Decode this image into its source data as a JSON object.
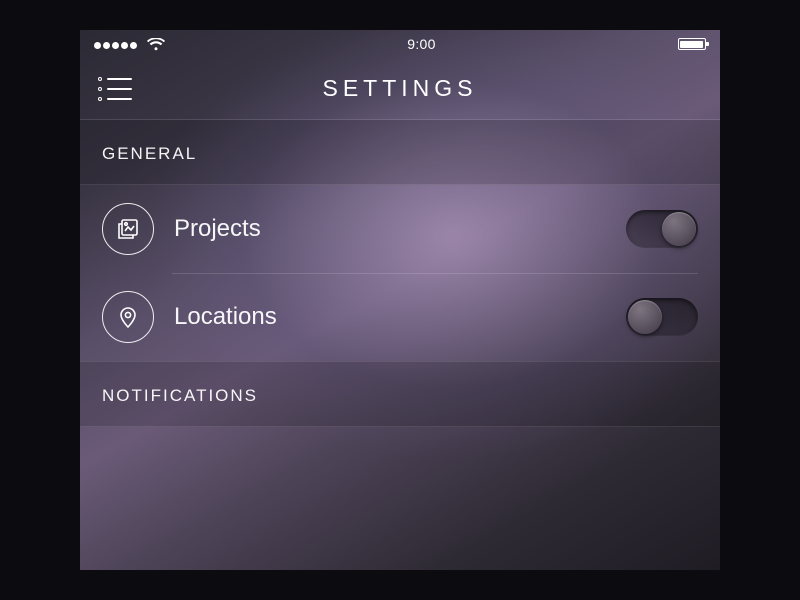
{
  "status": {
    "time": "9:00"
  },
  "header": {
    "title": "SETTINGS"
  },
  "sections": {
    "general": {
      "label": "GENERAL",
      "rows": {
        "projects": {
          "label": "Projects",
          "on": true
        },
        "locations": {
          "label": "Locations",
          "on": false
        }
      }
    },
    "notifications": {
      "label": "NOTIFICATIONS"
    }
  }
}
